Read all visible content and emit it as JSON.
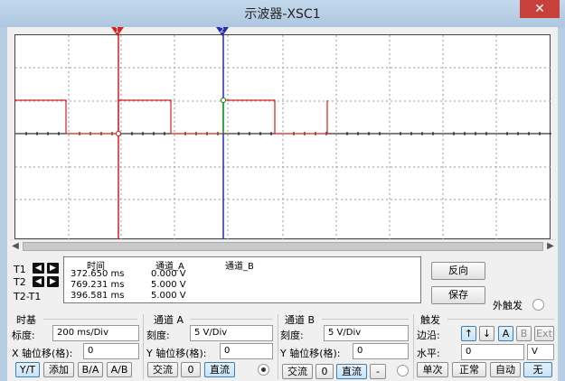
{
  "window": {
    "title": "示波器-XSC1",
    "close": "✕"
  },
  "cursors": {
    "t1_flag": "1",
    "t2_flag": "2"
  },
  "measurements": {
    "headers": {
      "time": "时间",
      "channel_a": "通道_A",
      "channel_b": "通道_B"
    },
    "rows": [
      {
        "label": "T1",
        "time": "372.650 ms",
        "a": "0.000 V",
        "b": ""
      },
      {
        "label": "T2",
        "time": "769.231 ms",
        "a": "5.000 V",
        "b": ""
      },
      {
        "label": "T2-T1",
        "time": "396.581 ms",
        "a": "5.000 V",
        "b": ""
      }
    ]
  },
  "buttons": {
    "reverse": "反向",
    "save": "保存",
    "ext_trigger": "外触发"
  },
  "timebase": {
    "title": "时基",
    "scale_label": "标度:",
    "scale_value": "200 ms/Div",
    "x_pos_label": "X 轴位移(格):",
    "x_pos_value": "0",
    "modes": [
      "Y/T",
      "添加",
      "B/A",
      "A/B"
    ]
  },
  "channel_a": {
    "title": "通道 A",
    "scale_label": "刻度:",
    "scale_value": "5  V/Div",
    "y_pos_label": "Y 轴位移(格):",
    "y_pos_value": "0",
    "coupling": [
      "交流",
      "0",
      "直流"
    ]
  },
  "channel_b": {
    "title": "通道 B",
    "scale_label": "刻度:",
    "scale_value": "5  V/Div",
    "y_pos_label": "Y 轴位移(格):",
    "y_pos_value": "0",
    "coupling": [
      "交流",
      "0",
      "直流",
      "-"
    ]
  },
  "trigger": {
    "title": "触发",
    "edge_label": "边沿:",
    "edge_buttons": [
      "↑",
      "↓",
      "A",
      "B",
      "Ext"
    ],
    "level_label": "水平:",
    "level_value": "0",
    "level_unit": "V",
    "modes": [
      "单次",
      "正常",
      "自动",
      "无"
    ]
  },
  "colors": {
    "trace_a": "#d81e1e",
    "cursor_t1": "#d81e1e",
    "cursor_t2": "#1e2bb5",
    "grid": "#9a9a9a"
  }
}
